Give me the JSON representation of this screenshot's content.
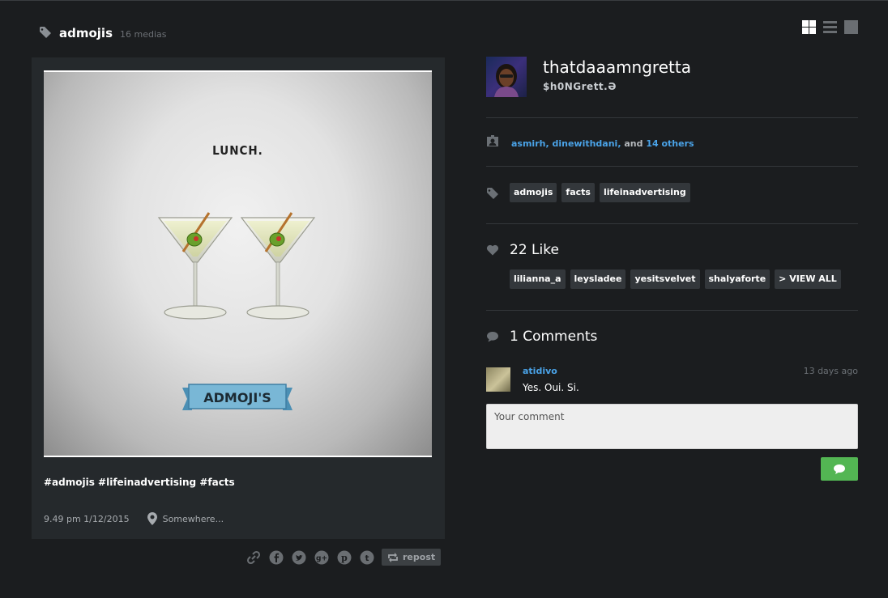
{
  "header": {
    "title": "admojis",
    "count": "16 medias"
  },
  "post": {
    "image_title": "LUNCH.",
    "image_banner": "ADMOJI'S",
    "caption": "#admojis #lifeinadvertising #facts",
    "timestamp": "9.49 pm 1/12/2015",
    "location": "Somewhere..."
  },
  "share": {
    "repost_label": "repost"
  },
  "profile": {
    "username": "thatdaaamngretta",
    "full_name": "$h0NGrett.Ə"
  },
  "tagged": {
    "users": "asmirh, dinewithdani,",
    "and": "and",
    "others": "14 others"
  },
  "tags": [
    "admojis",
    "facts",
    "lifeinadvertising"
  ],
  "likes": {
    "title": "22 Like",
    "users": [
      "lilianna_a",
      "leysladee",
      "yesitsvelvet",
      "shalyaforte"
    ],
    "view_all": "> VIEW ALL"
  },
  "comments": {
    "title": "1 Comments",
    "items": [
      {
        "user": "atidivo",
        "text": "Yes. Oui. Si.",
        "time": "13 days ago"
      }
    ],
    "placeholder": "Your comment"
  },
  "colors": {
    "background": "#1b1d1f",
    "card": "#25292c",
    "link": "#4aa3e8",
    "send_button": "#53b653"
  }
}
